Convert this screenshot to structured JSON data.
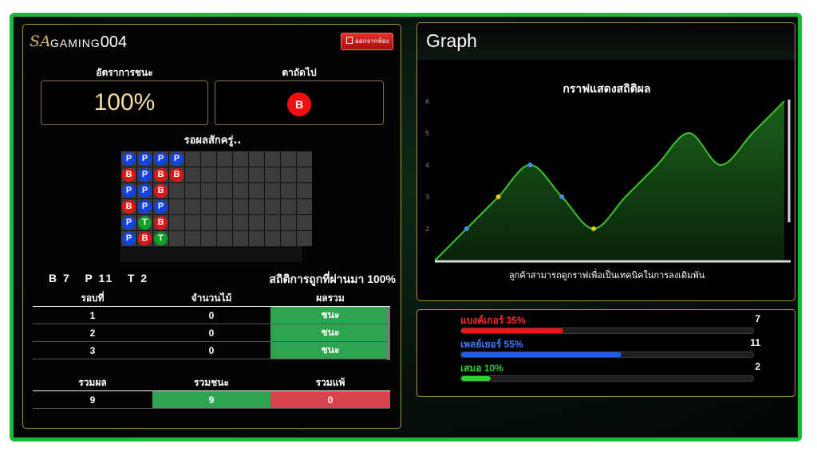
{
  "header": {
    "logo": "SA",
    "brand": "GAMING",
    "table_no": "004",
    "exit_label": "ออกจากห้อง"
  },
  "win_rate": {
    "label": "อัตราการชนะ",
    "value": "100%"
  },
  "next_card": {
    "label": "ตาถัดไป",
    "value": "B"
  },
  "waiting_text": "รอผลสักครู่..",
  "bead_road": {
    "columns": 12,
    "rows": 6,
    "grid": [
      [
        "P",
        "P",
        "P",
        "P",
        "",
        "",
        "",
        "",
        "",
        "",
        "",
        ""
      ],
      [
        "B",
        "P",
        "B",
        "B",
        "",
        "",
        "",
        "",
        "",
        "",
        "",
        ""
      ],
      [
        "P",
        "P",
        "B",
        "",
        "",
        "",
        "",
        "",
        "",
        "",
        "",
        ""
      ],
      [
        "B",
        "P",
        "P",
        "",
        "",
        "",
        "",
        "",
        "",
        "",
        "",
        ""
      ],
      [
        "P",
        "T",
        "B",
        "",
        "",
        "",
        "",
        "",
        "",
        "",
        "",
        ""
      ],
      [
        "P",
        "B",
        "T",
        "",
        "",
        "",
        "",
        "",
        "",
        "",
        "",
        ""
      ]
    ]
  },
  "counts": {
    "banker": "B 7",
    "player": "P 11",
    "tie": "T 2"
  },
  "accuracy_text": "สถิติการถูกที่ผ่านมา 100%",
  "rounds_table": {
    "headers": [
      "รอบที่",
      "จำนวนไม้",
      "ผลรวม"
    ],
    "rows": [
      [
        "1",
        "0",
        "ชนะ"
      ],
      [
        "2",
        "0",
        "ชนะ"
      ],
      [
        "3",
        "0",
        "ชนะ"
      ]
    ]
  },
  "summary_table": {
    "headers": [
      "รวมผล",
      "รวมชนะ",
      "รวมแพ้"
    ],
    "values": [
      "9",
      "9",
      "0"
    ]
  },
  "graph": {
    "panel_title": "Graph",
    "chart_title": "กราฟแสดงสถิติผล",
    "caption": "ลูกค้าสามารถดูกราฟเพื่อเป็นเทคนิคในการลงเดิมพัน"
  },
  "chart_data": {
    "type": "area",
    "ylim": [
      1,
      6
    ],
    "yticks": [
      2,
      3,
      4,
      5,
      6
    ],
    "series": [
      {
        "points": [
          [
            0,
            1
          ],
          [
            1,
            2
          ],
          [
            2,
            3
          ],
          [
            3,
            4
          ],
          [
            4,
            3
          ],
          [
            5,
            2
          ],
          [
            6,
            3
          ],
          [
            7,
            4
          ],
          [
            8,
            5
          ],
          [
            9,
            4
          ],
          [
            10,
            5
          ],
          [
            11,
            6
          ]
        ],
        "color": "#3ec42c"
      }
    ],
    "markers": [
      {
        "x": 1,
        "y": 2,
        "color": "#4a8cf0"
      },
      {
        "x": 2,
        "y": 3,
        "color": "#e8c81a"
      },
      {
        "x": 3,
        "y": 4,
        "color": "#4a8cf0"
      },
      {
        "x": 4,
        "y": 3,
        "color": "#4a8cf0"
      },
      {
        "x": 5,
        "y": 2,
        "color": "#e8c81a"
      }
    ],
    "grid": false,
    "legend": "none"
  },
  "stats": [
    {
      "label": "แบงค์เกอร์ 35%",
      "count": "7",
      "fraction": 0.35,
      "color": "#e81818"
    },
    {
      "label": "เพลย์เยอร์ 55%",
      "count": "11",
      "fraction": 0.55,
      "color": "#1f5ee6"
    },
    {
      "label": "เสมอ 10%",
      "count": "2",
      "fraction": 0.1,
      "color": "#2ad12a"
    }
  ]
}
